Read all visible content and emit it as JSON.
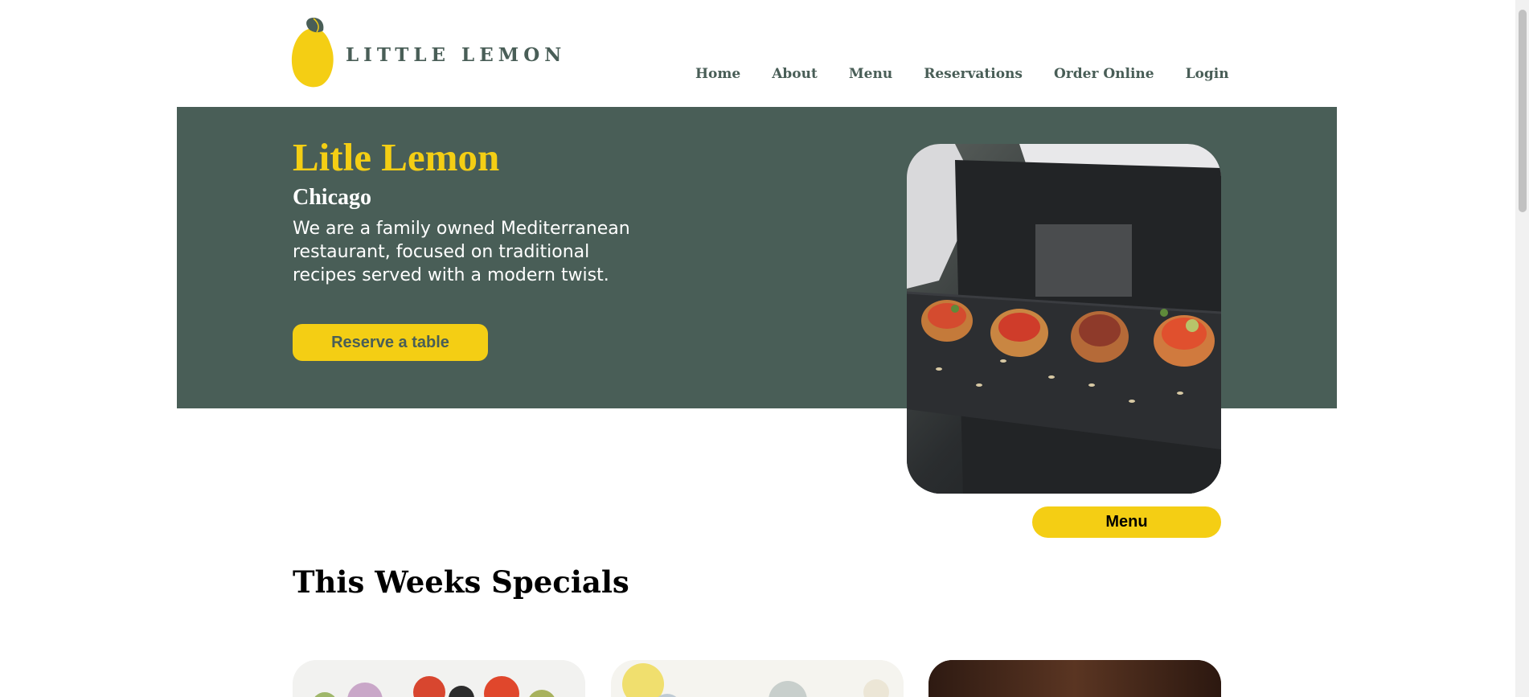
{
  "brand": {
    "name": "LITTLE LEMON",
    "colors": {
      "primary": "#495e57",
      "accent": "#f4ce14"
    }
  },
  "nav": {
    "items": [
      {
        "label": "Home"
      },
      {
        "label": "About"
      },
      {
        "label": "Menu"
      },
      {
        "label": "Reservations"
      },
      {
        "label": "Order Online"
      },
      {
        "label": "Login"
      }
    ]
  },
  "hero": {
    "title": "Litle Lemon",
    "subtitle": "Chicago",
    "description": "We are a family owned Mediterranean restaurant, focused on traditional recipes served with a modern twist.",
    "cta_label": "Reserve a table",
    "image_icon": "restaurant-food-image"
  },
  "menu_button": {
    "label": "Menu"
  },
  "specials": {
    "title": "This Weeks Specials"
  }
}
